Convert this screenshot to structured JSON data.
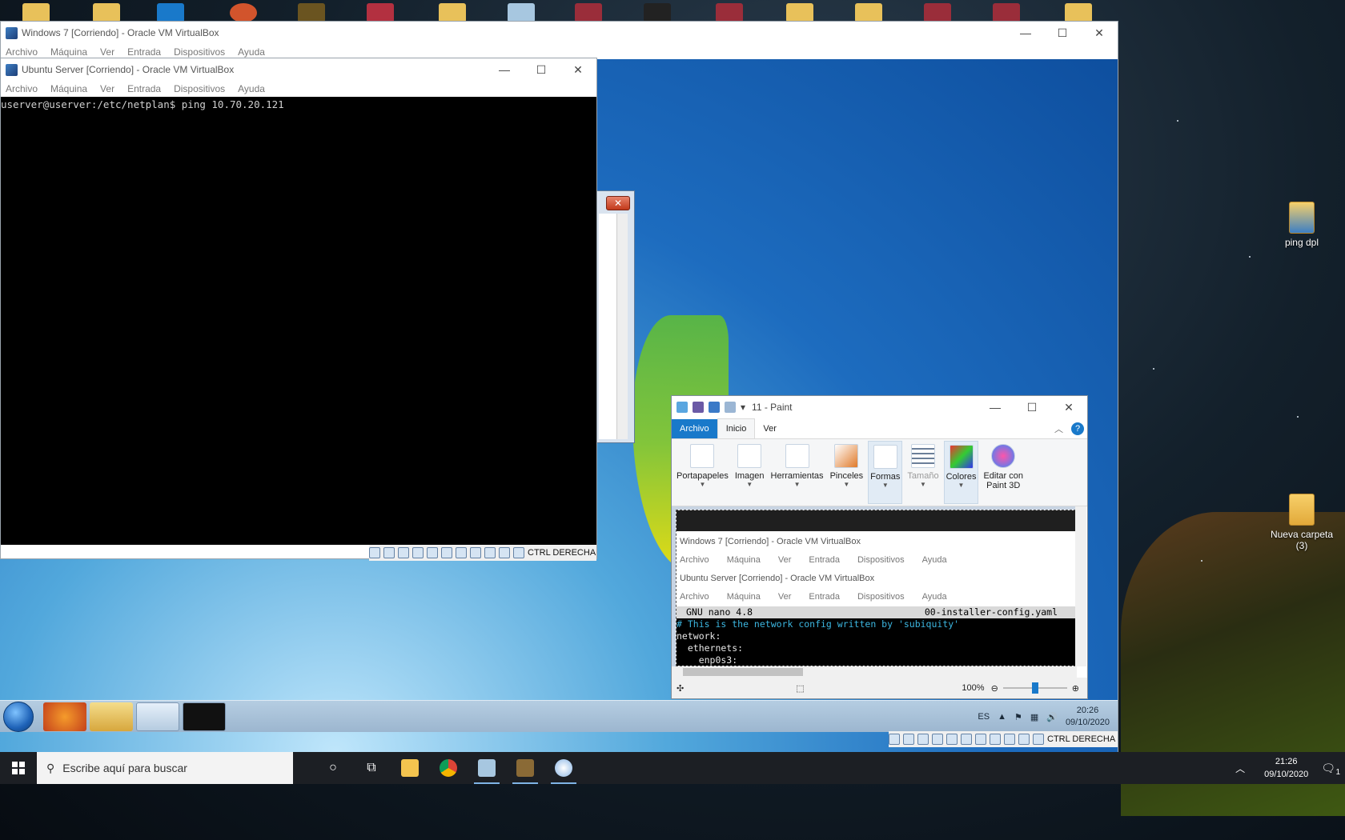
{
  "host": {
    "desktop_icons": [
      {
        "label": "ping dpl"
      },
      {
        "label": "Nueva carpeta (3)"
      }
    ],
    "taskbar": {
      "search_placeholder": "Escribe aquí para buscar",
      "clock_time": "21:26",
      "clock_date": "09/10/2020",
      "notification_count": "1"
    }
  },
  "win7_vm_window": {
    "title": "Windows 7  [Corriendo] - Oracle VM VirtualBox",
    "menu": [
      "Archivo",
      "Máquina",
      "Ver",
      "Entrada",
      "Dispositivos",
      "Ayuda"
    ],
    "status_hostkey": "CTRL DERECHA",
    "controls": {
      "minimize": "—",
      "maximize": "☐",
      "close": "✕"
    }
  },
  "ubuntu_vm_window": {
    "title": "Ubuntu Server [Corriendo] - Oracle VM VirtualBox",
    "menu": [
      "Archivo",
      "Máquina",
      "Ver",
      "Entrada",
      "Dispositivos",
      "Ayuda"
    ],
    "terminal_line": "userver@userver:/etc/netplan$ ping 10.70.20.121",
    "status_hostkey": "CTRL DERECHA",
    "controls": {
      "minimize": "—",
      "maximize": "☐",
      "close": "✕"
    }
  },
  "old_window": {
    "close": "✕"
  },
  "win7_guest": {
    "taskbar": {
      "lang": "ES",
      "clock_time": "20:26",
      "clock_date": "09/10/2020"
    }
  },
  "paint": {
    "title": "11 - Paint",
    "tabs": [
      "Archivo",
      "Inicio",
      "Ver"
    ],
    "ribbon": {
      "clipboard": "Portapapeles",
      "image": "Imagen",
      "tools": "Herramientas",
      "brushes": "Pinceles",
      "shapes": "Formas",
      "size": "Tamaño",
      "colors": "Colores",
      "edit3d_line1": "Editar con",
      "edit3d_line2": "Paint 3D"
    },
    "canvas": {
      "win7_title": "Windows 7  [Corriendo] - Oracle VM VirtualBox",
      "ubuntu_title": "Ubuntu Server [Corriendo] - Oracle VM VirtualBox",
      "menu": [
        "Archivo",
        "Máquina",
        "Ver",
        "Entrada",
        "Dispositivos",
        "Ayuda"
      ],
      "nano_version": "GNU nano 4.8",
      "nano_file": "00-installer-config.yaml",
      "nano_lines": [
        "# This is the network config written by 'subiquity'",
        "network:",
        "  ethernets:",
        "    enp0s3:"
      ]
    },
    "status": {
      "zoom": "100%"
    },
    "controls": {
      "minimize": "—",
      "maximize": "☐",
      "close": "✕"
    }
  },
  "colors": {
    "paint_file_tab": "#1979ca",
    "nano_comment": "#3cb6e0",
    "terminal_bg": "#000000"
  }
}
